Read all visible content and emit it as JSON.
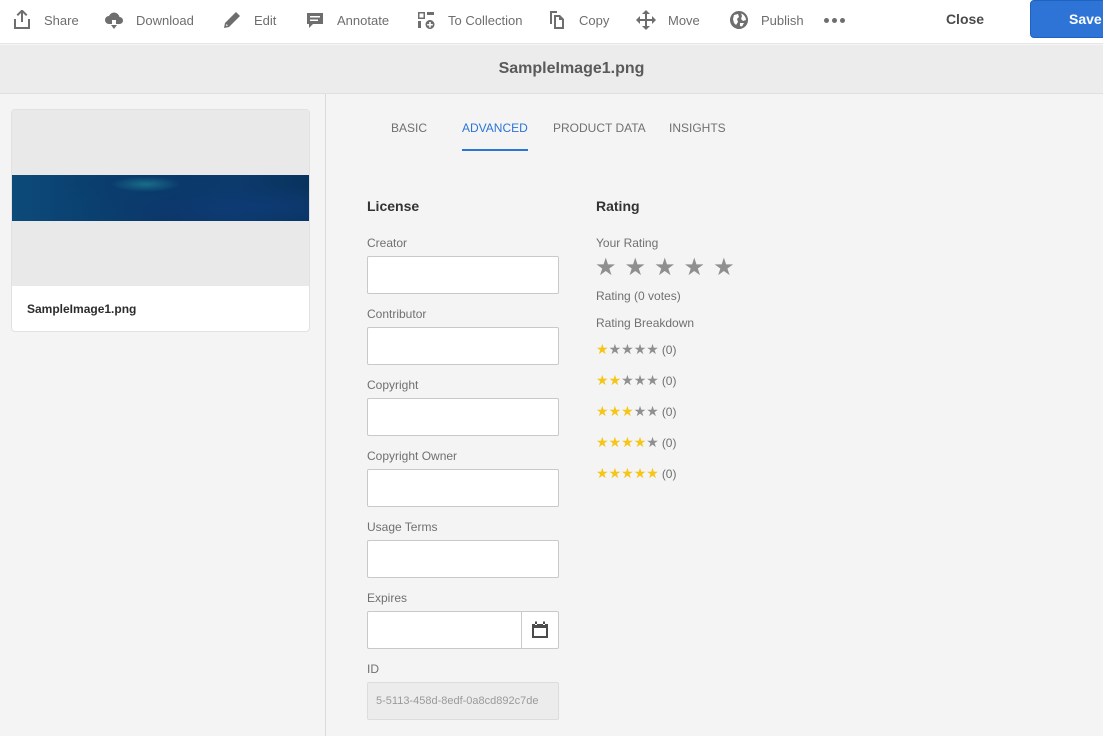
{
  "toolbar": {
    "share": "Share",
    "download": "Download",
    "edit": "Edit",
    "annotate": "Annotate",
    "to_collection": "To Collection",
    "copy": "Copy",
    "move": "Move",
    "publish": "Publish",
    "more_icon": "more-icon",
    "close": "Close",
    "save": "Save"
  },
  "title": "SampleImage1.png",
  "asset_card": {
    "name": "SampleImage1.png"
  },
  "tabs": [
    {
      "label": "BASIC",
      "active": false
    },
    {
      "label": "ADVANCED",
      "active": true
    },
    {
      "label": "PRODUCT DATA",
      "active": false
    },
    {
      "label": "INSIGHTS",
      "active": false
    }
  ],
  "license": {
    "heading": "License",
    "creator_label": "Creator",
    "creator_value": "",
    "contributor_label": "Contributor",
    "contributor_value": "",
    "copyright_label": "Copyright",
    "copyright_value": "",
    "copyright_owner_label": "Copyright Owner",
    "copyright_owner_value": "",
    "usage_terms_label": "Usage Terms",
    "usage_terms_value": "",
    "expires_label": "Expires",
    "expires_value": "",
    "id_label": "ID",
    "id_value": "5-5113-458d-8edf-0a8cd892c7de"
  },
  "rating": {
    "heading": "Rating",
    "your_rating_label": "Your Rating",
    "your_rating_value": 0,
    "summary": "Rating (0 votes)",
    "breakdown_label": "Rating Breakdown",
    "breakdown": [
      {
        "stars": 1,
        "count": "(0)"
      },
      {
        "stars": 2,
        "count": "(0)"
      },
      {
        "stars": 3,
        "count": "(0)"
      },
      {
        "stars": 4,
        "count": "(0)"
      },
      {
        "stars": 5,
        "count": "(0)"
      }
    ]
  },
  "colors": {
    "accent": "#2d74d6",
    "star_on": "#f5c518",
    "star_off": "#8f8f8f"
  }
}
